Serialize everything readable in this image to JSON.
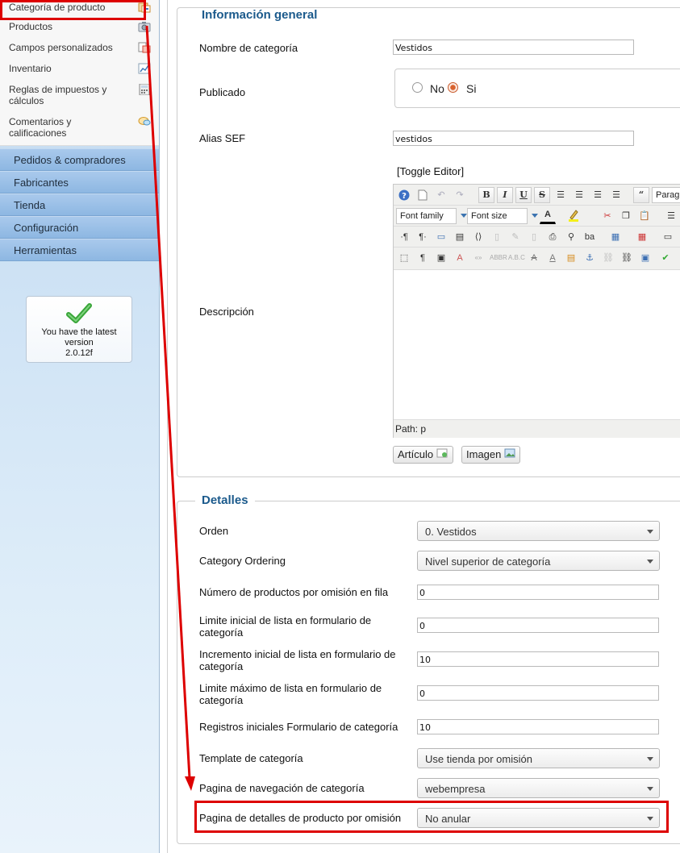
{
  "sidebar": {
    "sub_items": [
      {
        "label": "Categoría de producto",
        "icon": "category-icon"
      },
      {
        "label": "Productos",
        "icon": "camera-icon"
      },
      {
        "label": "Campos personalizados",
        "icon": "custom-fields-icon"
      },
      {
        "label": "Inventario",
        "icon": "chart-icon"
      },
      {
        "label": "Reglas de impuestos y cálculos",
        "icon": "calculator-icon"
      },
      {
        "label": "Comentarios y calificaciones",
        "icon": "speech-bubble-icon"
      }
    ],
    "sections": [
      "Pedidos & compradores",
      "Fabricantes",
      "Tienda",
      "Configuración",
      "Herramientas"
    ],
    "version": {
      "line1": "You have the latest",
      "line2": "version",
      "number": "2.0.12f"
    }
  },
  "general": {
    "legend": "Información general",
    "name_label": "Nombre de categoría",
    "name_value": "Vestidos",
    "published_label": "Publicado",
    "radio_no": "No",
    "radio_si": "Si",
    "published_selected": "Si",
    "alias_label": "Alias SEF",
    "alias_value": "vestidos",
    "description_label": "Descripción",
    "toggle_editor": "[Toggle Editor]",
    "font_family": "Font family",
    "font_size": "Font size",
    "paragraph": "Parag",
    "path_label": "Path:",
    "path_value": "p",
    "article_button": "Artículo",
    "image_button": "Imagen"
  },
  "details": {
    "legend": "Detalles",
    "order_label": "Orden",
    "order_value": "0. Vestidos",
    "cat_ordering_label": "Category Ordering",
    "cat_ordering_value": "Nivel superior de categoría",
    "products_row_label": "Número de productos por omisión en fila",
    "products_row_value": "0",
    "limit_start_label_1": "Limite inicial de lista en formulario de",
    "limit_start_label_2": "categoría",
    "limit_start_value": "0",
    "increment_label_1": "Incremento inicial de lista en formulario de",
    "increment_label_2": "categoría",
    "increment_value": "10",
    "limit_max_label_1": "Limite máximo de lista en formulario de",
    "limit_max_label_2": "categoría",
    "limit_max_value": "0",
    "initial_records_label": "Registros iniciales Formulario de categoría",
    "initial_records_value": "10",
    "template_label": "Template de categoría",
    "template_value": "Use tienda por omisión",
    "nav_page_label": "Pagina de navegación de categoría",
    "nav_page_value": "webempresa",
    "detail_page_label": "Pagina de detalles de producto por omisión",
    "detail_page_value": "No anular"
  },
  "colors": {
    "annotation": "#dd0000",
    "legend": "#1b5a8c",
    "menu_section": "#95bde6"
  }
}
